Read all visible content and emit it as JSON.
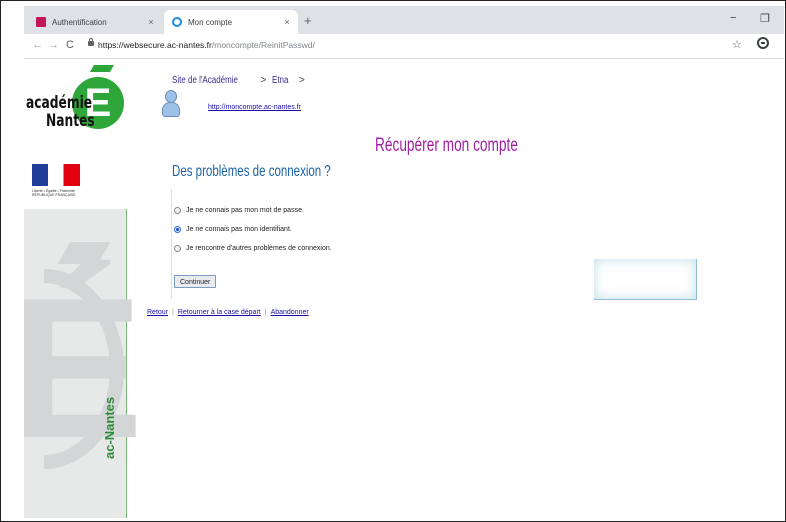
{
  "browser": {
    "tabs": [
      {
        "title": "Authentification",
        "close": "×",
        "active": false,
        "favicon_color": "#c2185b"
      },
      {
        "title": "Mon compte",
        "close": "×",
        "active": true,
        "favicon_color": "#1c8be0"
      }
    ],
    "new_tab": "+",
    "minimize": "−",
    "maximize": "❐",
    "back": "←",
    "forward": "→",
    "reload": "C",
    "url_host": "https://websecure.ac-nantes.fr",
    "url_path": "/moncompte/ReinitPasswd/",
    "bookmark_icon": "star-icon",
    "profile_icon": "account-circle-icon"
  },
  "brand": {
    "line1": "académie",
    "line2": "Nantes",
    "emblem_letter": "E",
    "marianne_caption": "Liberté • Égalité • Fraternité RÉPUBLIQUE FRANÇAISE",
    "colors": {
      "green": "#2ea63a",
      "purple": "#a020a0",
      "blue": "#1c63a8"
    },
    "sidebar_vertical_text": "ac-Nantes"
  },
  "breadcrumb": {
    "items": [
      "Site de l'Académie",
      "Etna"
    ],
    "separator": ">",
    "trailing": ">"
  },
  "account_link": "http://moncompte.ac-nantes.fr",
  "page_title": "Récupérer mon compte",
  "section_title": "Des problèmes de connexion ?",
  "options": [
    {
      "label": "Je ne connais pas mon mot de passe.",
      "selected": false
    },
    {
      "label": "Je ne connais pas mon identifiant.",
      "selected": true
    },
    {
      "label": "Je rencontre d'autres problèmes de connexion.",
      "selected": false
    }
  ],
  "submit_label": "Continuer",
  "footer_links": [
    "Retour",
    "Retourner à la case départ",
    "Abandonner"
  ]
}
